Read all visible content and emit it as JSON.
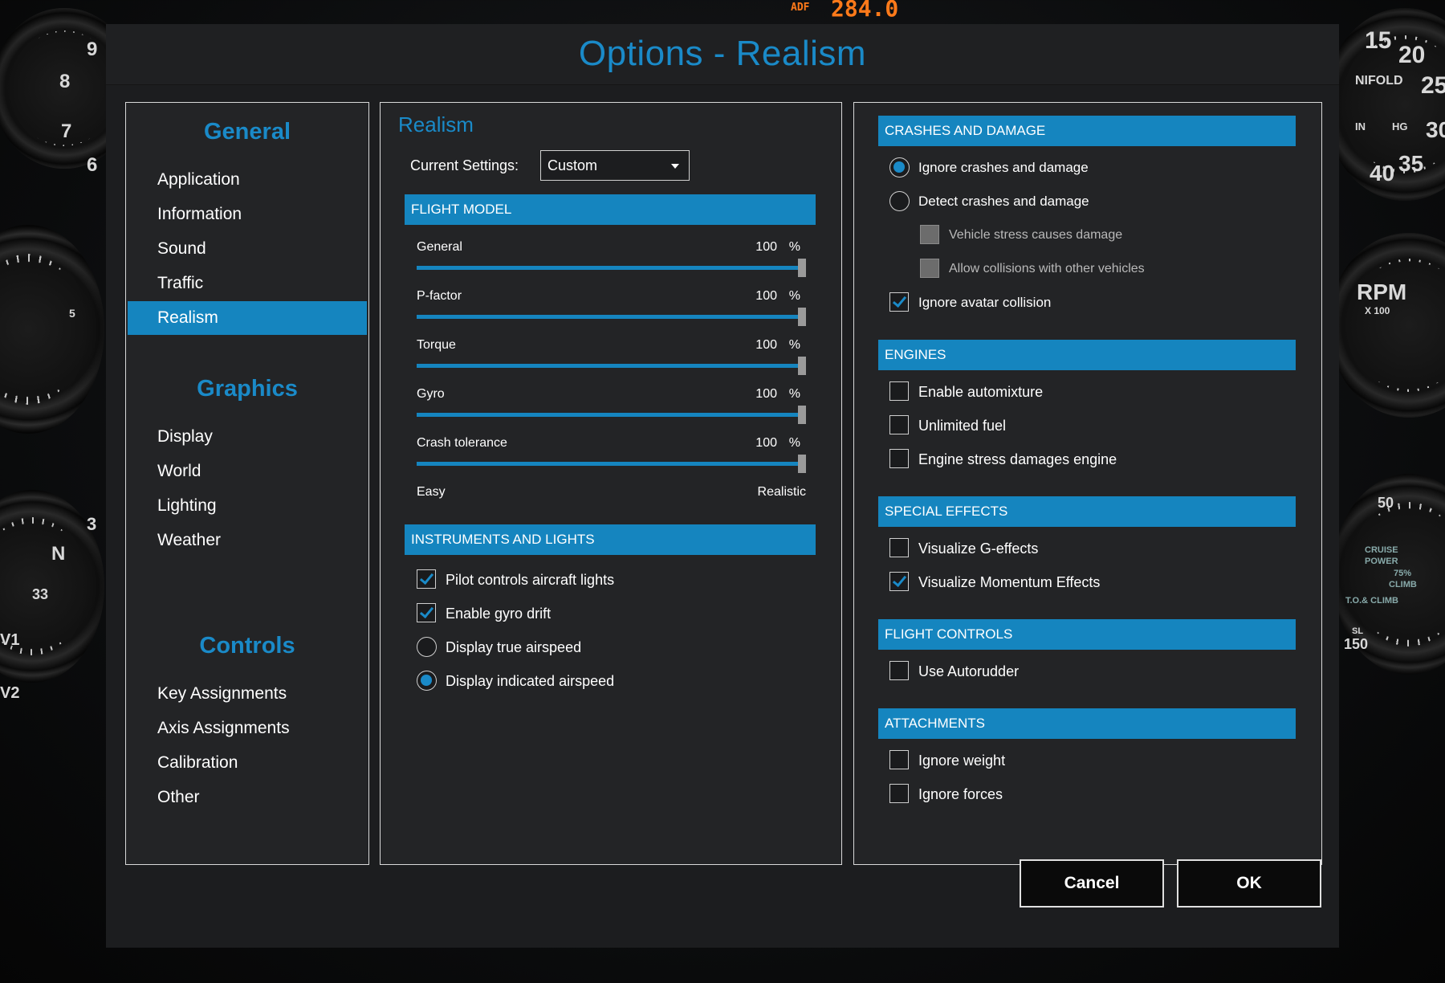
{
  "background": {
    "adf_label": "ADF",
    "adf_value": "284.0",
    "gauge_labels": [
      "9",
      "8",
      "7",
      "6",
      "5",
      "3",
      "N",
      "33",
      "V1",
      "V2",
      "15",
      "20",
      "25",
      "30",
      "35",
      "40",
      "IN",
      "HG",
      "NIFOLD",
      "RPM",
      "X 100",
      "50",
      "150",
      "CRUISE POWER",
      "75%",
      "CLIMB",
      "T.O.& CLIMB",
      "SL"
    ]
  },
  "window": {
    "title": "Options - Realism"
  },
  "nav": {
    "sections": [
      {
        "heading": "General",
        "items": [
          "Application",
          "Information",
          "Sound",
          "Traffic",
          "Realism"
        ]
      },
      {
        "heading": "Graphics",
        "items": [
          "Display",
          "World",
          "Lighting",
          "Weather"
        ]
      },
      {
        "heading": "Controls",
        "items": [
          "Key Assignments",
          "Axis Assignments",
          "Calibration",
          "Other"
        ]
      }
    ],
    "active": "Realism"
  },
  "realism": {
    "title": "Realism",
    "current_settings_label": "Current Settings:",
    "current_settings_value": "Custom",
    "flight_model": {
      "header": "FLIGHT MODEL",
      "sliders": [
        {
          "label": "General",
          "value": "100",
          "unit": "%",
          "percent": 100
        },
        {
          "label": "P-factor",
          "value": "100",
          "unit": "%",
          "percent": 100
        },
        {
          "label": "Torque",
          "value": "100",
          "unit": "%",
          "percent": 100
        },
        {
          "label": "Gyro",
          "value": "100",
          "unit": "%",
          "percent": 100
        },
        {
          "label": "Crash tolerance",
          "value": "100",
          "unit": "%",
          "percent": 100
        }
      ],
      "scale_min": "Easy",
      "scale_max": "Realistic"
    },
    "instruments": {
      "header": "INSTRUMENTS AND LIGHTS",
      "options": [
        {
          "type": "checkbox",
          "label": "Pilot controls aircraft lights",
          "checked": true
        },
        {
          "type": "checkbox",
          "label": "Enable gyro drift",
          "checked": true
        },
        {
          "type": "radio",
          "label": "Display true airspeed",
          "checked": false
        },
        {
          "type": "radio",
          "label": "Display indicated airspeed",
          "checked": true
        }
      ]
    }
  },
  "right": {
    "crashes": {
      "header": "CRASHES AND DAMAGE",
      "options": [
        {
          "type": "radio",
          "label": "Ignore crashes and damage",
          "checked": true
        },
        {
          "type": "radio",
          "label": "Detect crashes and damage",
          "checked": false
        },
        {
          "type": "checkbox",
          "label": "Vehicle stress causes damage",
          "checked": false,
          "disabled": true
        },
        {
          "type": "checkbox",
          "label": "Allow collisions with other vehicles",
          "checked": false,
          "disabled": true
        },
        {
          "type": "checkbox",
          "label": "Ignore avatar collision",
          "checked": true
        }
      ]
    },
    "engines": {
      "header": "ENGINES",
      "options": [
        {
          "type": "checkbox",
          "label": "Enable automixture",
          "checked": false
        },
        {
          "type": "checkbox",
          "label": "Unlimited fuel",
          "checked": false
        },
        {
          "type": "checkbox",
          "label": "Engine stress damages engine",
          "checked": false
        }
      ]
    },
    "effects": {
      "header": "SPECIAL EFFECTS",
      "options": [
        {
          "type": "checkbox",
          "label": "Visualize G-effects",
          "checked": false
        },
        {
          "type": "checkbox",
          "label": "Visualize Momentum Effects",
          "checked": true
        }
      ]
    },
    "controls": {
      "header": "FLIGHT CONTROLS",
      "options": [
        {
          "type": "checkbox",
          "label": "Use Autorudder",
          "checked": false
        }
      ]
    },
    "attachments": {
      "header": "ATTACHMENTS",
      "options": [
        {
          "type": "checkbox",
          "label": "Ignore weight",
          "checked": false
        },
        {
          "type": "checkbox",
          "label": "Ignore forces",
          "checked": false
        }
      ]
    }
  },
  "buttons": {
    "cancel": "Cancel",
    "ok": "OK"
  },
  "colors": {
    "accent": "#1585bf",
    "title": "#1a8ac8",
    "panel": "#232426",
    "border": "#d9d9d9"
  }
}
